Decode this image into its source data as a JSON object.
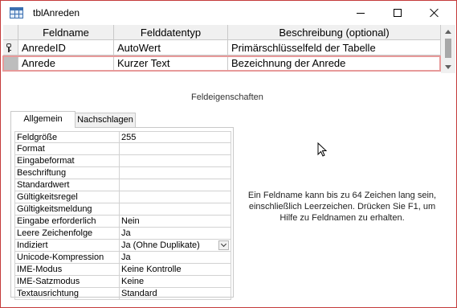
{
  "window": {
    "title": "tblAnreden",
    "icon": "table-icon",
    "controls": [
      "minimize-icon",
      "maximize-icon",
      "close-icon"
    ]
  },
  "grid": {
    "columns": [
      "Feldname",
      "Felddatentyp",
      "Beschreibung (optional)"
    ],
    "rows": [
      {
        "selector_icon": "primary-key-icon",
        "name": "AnredeID",
        "type": "AutoWert",
        "description": "Primärschlüsselfeld der Tabelle"
      },
      {
        "selector_icon": "",
        "name": "Anrede",
        "type": "Kurzer Text",
        "description": "Bezeichnung der Anrede",
        "selected": true
      }
    ]
  },
  "properties": {
    "caption": "Feldeigenschaften",
    "tabs": [
      "Allgemein",
      "Nachschlagen"
    ],
    "active_tab": "Allgemein",
    "rows": [
      {
        "label": "Feldgröße",
        "value": "255"
      },
      {
        "label": "Format",
        "value": ""
      },
      {
        "label": "Eingabeformat",
        "value": ""
      },
      {
        "label": "Beschriftung",
        "value": ""
      },
      {
        "label": "Standardwert",
        "value": ""
      },
      {
        "label": "Gültigkeitsregel",
        "value": ""
      },
      {
        "label": "Gültigkeitsmeldung",
        "value": ""
      },
      {
        "label": "Eingabe erforderlich",
        "value": "Nein"
      },
      {
        "label": "Leere Zeichenfolge",
        "value": "Ja"
      },
      {
        "label": "Indiziert",
        "value": "Ja (Ohne Duplikate)",
        "dropdown": true
      },
      {
        "label": "Unicode-Kompression",
        "value": "Ja"
      },
      {
        "label": "IME-Modus",
        "value": "Keine Kontrolle"
      },
      {
        "label": "IME-Satzmodus",
        "value": "Keine"
      },
      {
        "label": "Textausrichtung",
        "value": "Standard"
      }
    ],
    "help_text": "Ein Feldname kann bis zu 64 Zeichen lang sein, einschließlich Leerzeichen. Drücken Sie F1, um Hilfe zu Feldnamen zu erhalten."
  },
  "colors": {
    "window_border": "#c43b3b",
    "selected_row_outline": "#e79a9a",
    "header_bg": "#f0f0f0"
  }
}
